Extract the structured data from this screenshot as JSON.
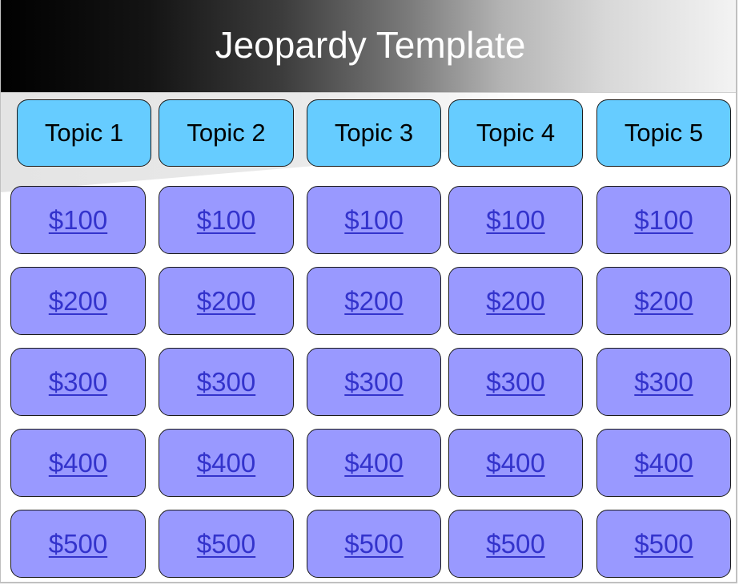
{
  "header": {
    "title": "Jeopardy Template"
  },
  "colors": {
    "topic_fill": "#66ccff",
    "money_fill": "#9999ff",
    "link_text": "#3333cc",
    "title_text": "#ffffff"
  },
  "board": {
    "topics": [
      {
        "label": "Topic 1"
      },
      {
        "label": "Topic 2"
      },
      {
        "label": "Topic 3"
      },
      {
        "label": "Topic 4"
      },
      {
        "label": "Topic 5"
      }
    ],
    "rows": [
      {
        "value": "$100",
        "cells": [
          "$100",
          "$100",
          "$100",
          "$100",
          "$100"
        ]
      },
      {
        "value": "$200",
        "cells": [
          "$200",
          "$200",
          "$200",
          "$200",
          "$200"
        ]
      },
      {
        "value": "$300",
        "cells": [
          "$300",
          "$300",
          "$300",
          "$300",
          "$300"
        ]
      },
      {
        "value": "$400",
        "cells": [
          "$400",
          "$400",
          "$400",
          "$400",
          "$400"
        ]
      },
      {
        "value": "$500",
        "cells": [
          "$500",
          "$500",
          "$500",
          "$500",
          "$500"
        ]
      }
    ]
  }
}
